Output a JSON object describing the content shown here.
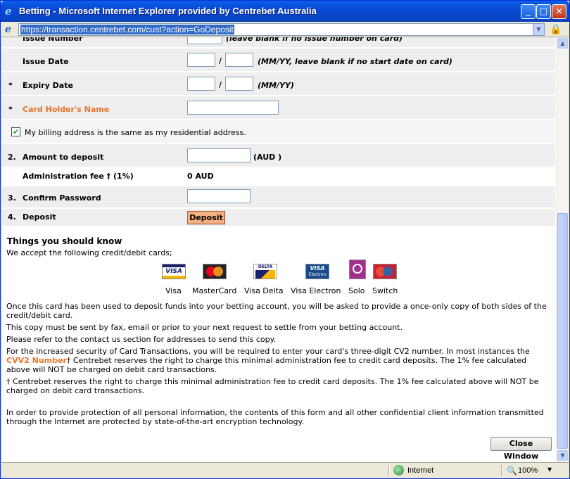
{
  "window": {
    "title": "Betting - Microsoft Internet Explorer provided by Centrebet Australia",
    "address": "https://transaction.centrebet.com/cust?action=GoDeposit"
  },
  "form": {
    "issue_number_label": "Issue Number",
    "issue_number_hint": "(leave blank if no issue number on card)",
    "issue_date_label": "Issue Date",
    "issue_date_hint": "(MM/YY, leave blank if no start date on card)",
    "expiry_date_label": "Expiry Date",
    "expiry_date_hint": "(MM/YY)",
    "card_holder_label": "Card Holder's Name",
    "billing_checkbox_label": "My billing address is the same as my residential address.",
    "billing_checked": true,
    "amount_num": "2.",
    "amount_label": "Amount to deposit",
    "amount_unit": "(AUD )",
    "admin_fee_label": "Administration fee † (1%)",
    "admin_fee_value": "0 AUD",
    "confirm_num": "3.",
    "confirm_label": "Confirm Password",
    "deposit_num": "4.",
    "deposit_label": "Deposit",
    "deposit_button": "Deposit",
    "required_mark": "*",
    "slash": "/"
  },
  "info": {
    "title": "Things you should know",
    "accept_text": "We accept the following credit/debit cards;",
    "cards": [
      {
        "name": "Visa",
        "icon": "visa-icon",
        "color": "#1a1f71"
      },
      {
        "name": "MasterCard",
        "icon": "mastercard-icon",
        "color": "#eb001b"
      },
      {
        "name": "Visa Delta",
        "icon": "visa-delta-icon",
        "color": "#1a1f71"
      },
      {
        "name": "Visa Electron",
        "icon": "visa-electron-icon",
        "color": "#1a4c8c"
      },
      {
        "name": "Solo",
        "icon": "solo-icon",
        "color": "#a0308c"
      },
      {
        "name": "Switch",
        "icon": "switch-icon",
        "color": "#cc1f2f"
      }
    ],
    "para1": "Once this card has been used to deposit funds into your betting account, you will be asked to provide a once-only copy of both sides of the credit/debit card.",
    "para2": "This copy must be sent by fax, email or prior to your next request to settle from your betting account.",
    "para3": "Please refer to the contact us section for addresses to send this copy.",
    "para4_start": "For the increased security of Card Transactions, you will be required to enter your card's three-digit CV2 number. In most instances the ",
    "para4_link": "CVV2 Number",
    "para4_end": "† Centrebet reserves the right to charge this minimal administration fee to credit card deposits. The 1% fee calculated above will NOT be charged on debit card transactions.",
    "para5": "† Centrebet reserves the right to charge this minimal administration fee to credit card deposits. The 1% fee calculated above will NOT be charged on debit card transactions.",
    "para6": "In order to provide protection of all personal information, the contents of this form and all other confidential client information transmitted through the Internet are protected by state-of-the-art encryption technology.",
    "close_button": "Close Window"
  },
  "status": {
    "zone": "Internet",
    "zoom": "100%"
  }
}
